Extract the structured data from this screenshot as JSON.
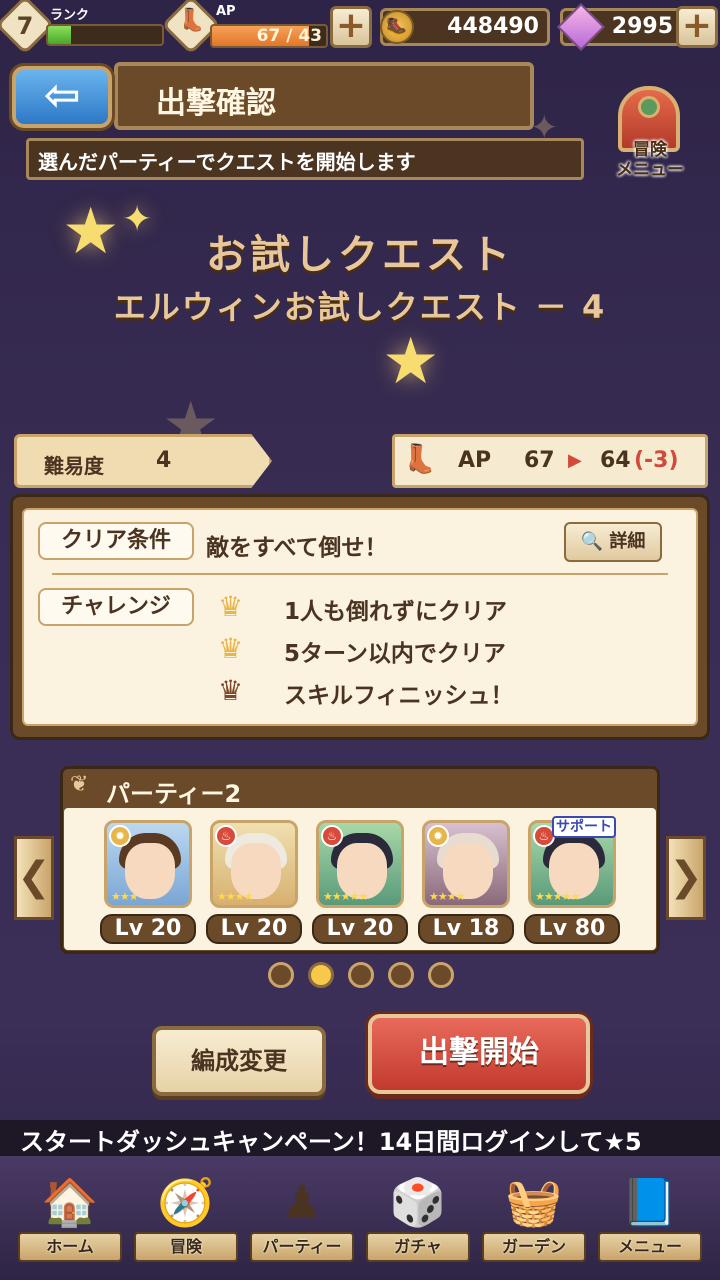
{
  "status": {
    "rank_level": "7",
    "rank_label": "ランク",
    "rank_progress": 0.2,
    "ap_label": "AP",
    "ap_text": "67 / 43",
    "ap_progress": 0.85,
    "gold": "448490",
    "gems": "2995",
    "plus_label": "+"
  },
  "header": {
    "back_label": "⇦",
    "title": "出撃確認",
    "subtitle": "選んだパーティーでクエストを開始します",
    "adventure_menu_label": "冒険\nメニュー"
  },
  "quest": {
    "title": "お試しクエスト",
    "subtitle": "エルウィンお試しクエスト － 4",
    "difficulty_label": "難易度",
    "difficulty_value": "4",
    "ap_label": "AP",
    "ap_from": "67",
    "ap_to": "64",
    "ap_diff": "(-3)"
  },
  "conditions": {
    "clear_tag": "クリア条件",
    "clear_text": "敵をすべて倒せ！",
    "detail_label": "詳細",
    "challenge_tag": "チャレンジ",
    "challenges": [
      {
        "text": "1人も倒れずにクリア",
        "achieved": true
      },
      {
        "text": "5ターン以内でクリア",
        "achieved": true
      },
      {
        "text": "スキルフィニッシュ！",
        "achieved": false
      }
    ]
  },
  "party": {
    "title": "パーティー2",
    "support_label": "サポート",
    "members": [
      {
        "level": "Lv 20",
        "element": "light",
        "stars": 3
      },
      {
        "level": "Lv 20",
        "element": "fire",
        "stars": 4
      },
      {
        "level": "Lv 20",
        "element": "fire",
        "stars": 5
      },
      {
        "level": "Lv 18",
        "element": "light",
        "stars": 4
      },
      {
        "level": "Lv 80",
        "element": "fire",
        "stars": 5,
        "support": true
      }
    ],
    "page_count": 5,
    "active_page": 2
  },
  "actions": {
    "edit_label": "編成変更",
    "start_label": "出撃開始"
  },
  "ticker": {
    "text": "スタートダッシュキャンペーン！14日間ログインして★5"
  },
  "nav": {
    "items": [
      {
        "label": "ホーム",
        "icon": "house-icon"
      },
      {
        "label": "冒険",
        "icon": "scroll-icon"
      },
      {
        "label": "パーティー",
        "icon": "chess-icon"
      },
      {
        "label": "ガチャ",
        "icon": "dice-icon"
      },
      {
        "label": "ガーデン",
        "icon": "basket-icon"
      },
      {
        "label": "メニュー",
        "icon": "book-icon"
      }
    ]
  },
  "colors": {
    "accent_red": "#c23a2e",
    "panel_brown": "#6b4a29",
    "cream": "#fbf3e0"
  }
}
